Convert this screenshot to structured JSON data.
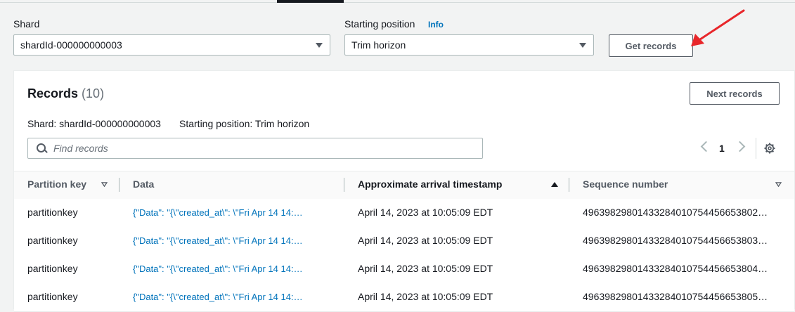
{
  "form": {
    "shard_label": "Shard",
    "shard_value": "shardId-000000000003",
    "starting_position_label": "Starting position",
    "info_label": "Info",
    "starting_position_value": "Trim horizon",
    "get_records_label": "Get records"
  },
  "records": {
    "title": "Records",
    "count": "(10)",
    "next_records_label": "Next records",
    "shard_info": "Shard: shardId-000000000003",
    "starting_position_info": "Starting position: Trim horizon",
    "search_placeholder": "Find records",
    "page": "1"
  },
  "table": {
    "columns": [
      "Partition key",
      "Data",
      "Approximate arrival timestamp",
      "Sequence number"
    ],
    "rows": [
      {
        "partition_key": "partitionkey",
        "data": "{\"Data\": \"{\\\"created_at\\\": \\\"Fri Apr 14 14:…",
        "timestamp": "April 14, 2023 at 10:05:09 EDT",
        "sequence": "4963982980143328401075445665380​2…"
      },
      {
        "partition_key": "partitionkey",
        "data": "{\"Data\": \"{\\\"created_at\\\": \\\"Fri Apr 14 14:…",
        "timestamp": "April 14, 2023 at 10:05:09 EDT",
        "sequence": "49639829801433284010754456653803…"
      },
      {
        "partition_key": "partitionkey",
        "data": "{\"Data\": \"{\\\"created_at\\\": \\\"Fri Apr 14 14:…",
        "timestamp": "April 14, 2023 at 10:05:09 EDT",
        "sequence": "49639829801433284010754456653804…"
      },
      {
        "partition_key": "partitionkey",
        "data": "{\"Data\": \"{\\\"created_at\\\": \\\"Fri Apr 14 14:…",
        "timestamp": "April 14, 2023 at 10:05:09 EDT",
        "sequence": "49639829801433284010754456653805…"
      }
    ]
  },
  "colors": {
    "accent_link": "#0073bb",
    "annotation_arrow": "#e8262a"
  },
  "icons": [
    "caret-down-icon",
    "search-icon",
    "chevron-left-icon",
    "chevron-right-icon",
    "gear-icon",
    "sort-descending-icon",
    "sort-ascending-icon",
    "red-arrow-annotation"
  ]
}
